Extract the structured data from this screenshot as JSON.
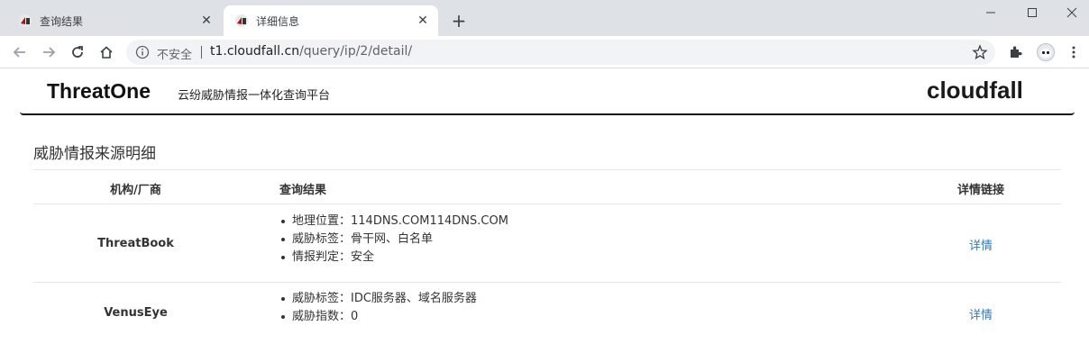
{
  "browser": {
    "tabs": [
      {
        "title": "查询结果",
        "close": "✕"
      },
      {
        "title": "详细信息",
        "close": "✕"
      }
    ],
    "new_tab": "+",
    "window_controls": {
      "minimize": "—",
      "maximize": "☐",
      "close": "✕"
    },
    "omnibox": {
      "security_label": "不安全",
      "url_host": "t1.cloudfall.cn",
      "url_path": "/query/ip/2/detail/"
    },
    "icons": {
      "back": "arrow-left-icon",
      "forward": "arrow-right-icon",
      "reload": "reload-icon",
      "home": "home-icon",
      "info": "info-icon",
      "star": "star-icon",
      "extensions": "puzzle-icon",
      "profile": "avatar-icon",
      "menu": "kebab-menu-icon"
    }
  },
  "site": {
    "brand": "ThreatOne",
    "tagline": "云纷威胁情报一体化查询平台",
    "logo_text": "cloudfall",
    "accent_color": "#a8121c"
  },
  "section": {
    "title": "威胁情报来源明细"
  },
  "table": {
    "headers": {
      "vendor": "机构/厂商",
      "result": "查询结果",
      "link": "详情链接"
    },
    "rows": [
      {
        "vendor": "ThreatBook",
        "results": [
          "地理位置：114DNS.COM114DNS.COM",
          "威胁标签：骨干网、白名单",
          "情报判定：安全"
        ],
        "link": "详情"
      },
      {
        "vendor": "VenusEye",
        "results": [
          "威胁标签：IDC服务器、域名服务器",
          "威胁指数：0"
        ],
        "link": "详情"
      }
    ]
  }
}
